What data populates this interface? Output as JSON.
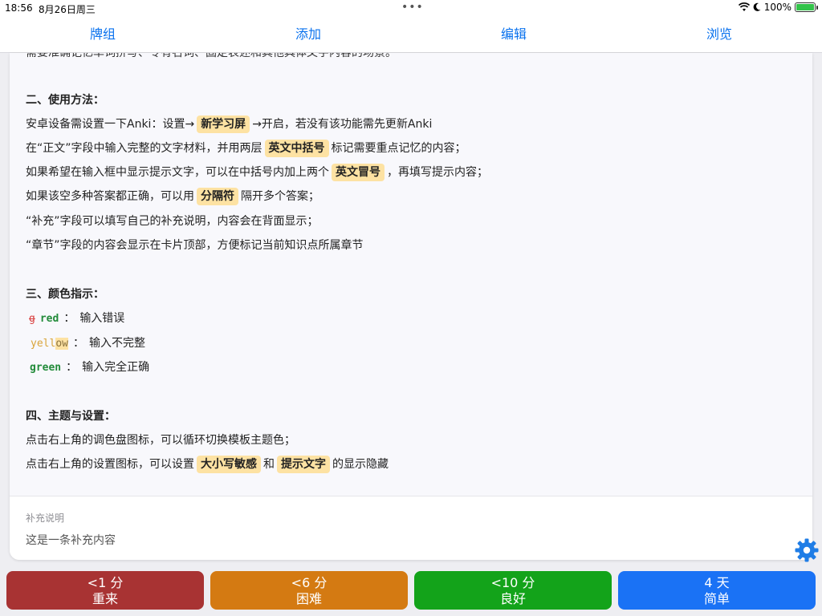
{
  "status": {
    "time": "18:56",
    "date": "8月26日周三",
    "dots": "•••",
    "battery": "100%"
  },
  "tabs": [
    "牌组",
    "添加",
    "编辑",
    "浏览"
  ],
  "content": {
    "cut_line": "需要准确记忆单词拼写、专有名词、固定表述和其他具体文字内容的场景。",
    "section2": {
      "title": "二、使用方法：",
      "l1a": "安卓设备需设置一下Anki：设置→",
      "l1b": "新学习屏",
      "l1c": "→开启，若没有该功能需先更新Anki",
      "l2a": "在“正文”字段中输入完整的文字材料，并用两层",
      "l2b": "英文中括号",
      "l2c": "标记需要重点记忆的内容；",
      "l3a": "如果希望在输入框中显示提示文字，可以在中括号内加上两个",
      "l3b": "英文冒号",
      "l3c": "，再填写提示内容；",
      "l4a": "如果该空多种答案都正确，可以用",
      "l4b": "分隔符",
      "l4c": "隔开多个答案；",
      "l5": "“补充”字段可以填写自己的补充说明，内容会在背面显示；",
      "l6": "“章节”字段的内容会显示在卡片顶部，方便标记当前知识点所属章节"
    },
    "section3": {
      "title": "三、颜色指示：",
      "red_strike": "g",
      "red_word": "red",
      "red_desc": "输入错误",
      "yellow_a": "yell",
      "yellow_b": "ow",
      "yellow_desc": "输入不完整",
      "green_word": "green",
      "green_desc": "输入完全正确",
      "colon": "："
    },
    "section4": {
      "title": "四、主题与设置：",
      "l1": "点击右上角的调色盘图标，可以循环切换模板主题色；",
      "l2a": "点击右上角的设置图标，可以设置",
      "l2b": "大小写敏感",
      "l2c": "和",
      "l2d": "提示文字",
      "l2e": "的显示隐藏"
    }
  },
  "supplement": {
    "label": "补充说明",
    "text": "这是一条补充内容"
  },
  "answers": [
    {
      "interval": "<1 分",
      "label": "重来",
      "color": "#a83333"
    },
    {
      "interval": "<6 分",
      "label": "困难",
      "color": "#d47a12"
    },
    {
      "interval": "<10 分",
      "label": "良好",
      "color": "#13a31a"
    },
    {
      "interval": "4 天",
      "label": "简单",
      "color": "#1a72f5"
    }
  ],
  "colors": {
    "accent": "#0a72ee",
    "highlight": "#fde2a3",
    "gear": "#1f7de6"
  }
}
